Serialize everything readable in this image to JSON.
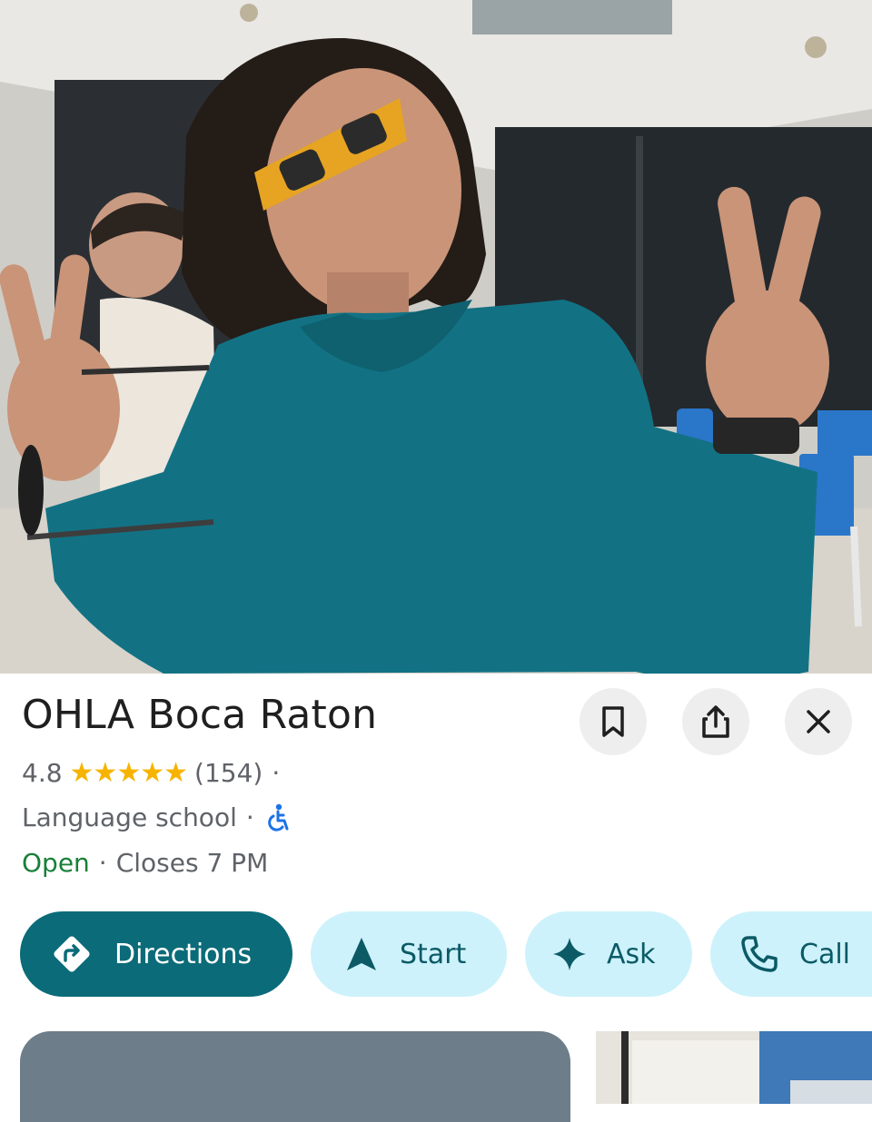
{
  "place": {
    "name": "OHLA Boca Raton",
    "rating": "4.8",
    "stars": "★★★★★",
    "review_count": "(154)",
    "rating_separator": "·",
    "category": "Language school",
    "category_separator": "·",
    "accessibility_icon": "wheelchair-icon",
    "open_status": "Open",
    "hours_separator": "·",
    "closes_text": "Closes 7 PM"
  },
  "actions": {
    "directions": "Directions",
    "start": "Start",
    "ask": "Ask",
    "call": "Call"
  },
  "header_buttons": {
    "save_icon": "bookmark-icon",
    "share_icon": "share-icon",
    "close_icon": "close-icon"
  },
  "colors": {
    "primary": "#0b6b78",
    "chip_bg": "#cdf2fb",
    "stars": "#f6b400",
    "open": "#188038",
    "accessibility": "#1a73e8"
  }
}
